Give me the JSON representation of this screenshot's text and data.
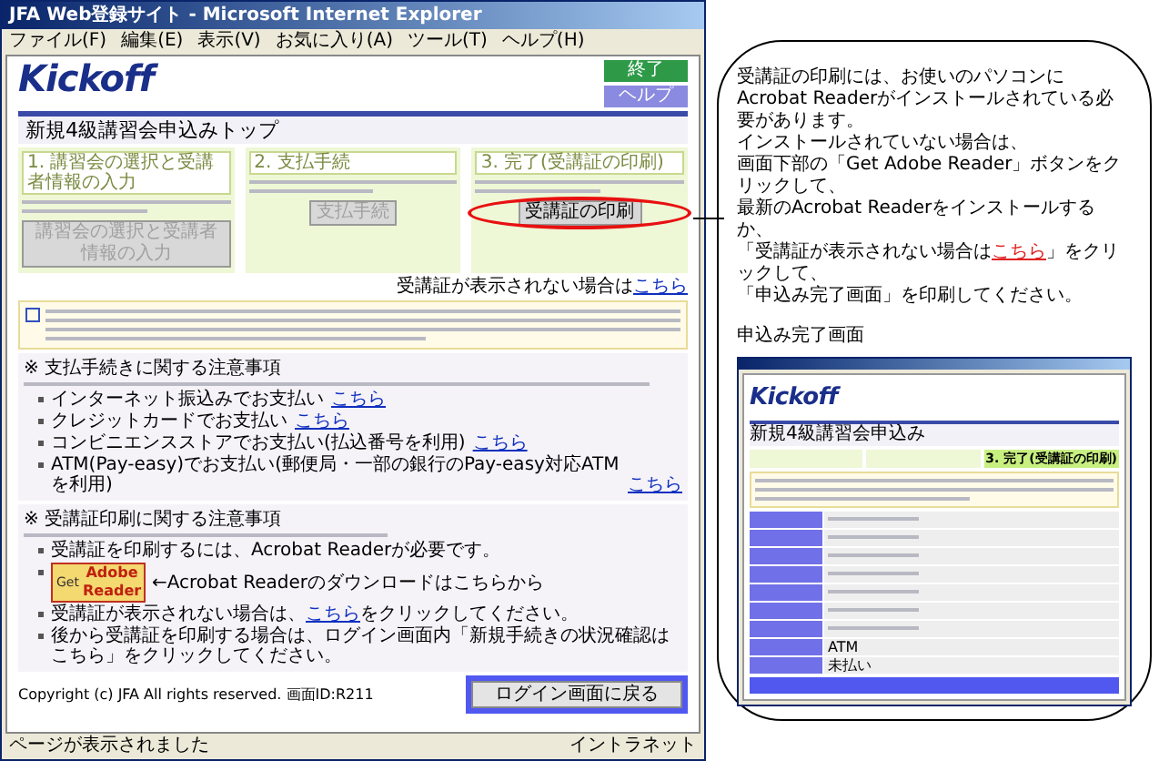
{
  "browser": {
    "title": "JFA Web登録サイト - Microsoft Internet Explorer",
    "menu": [
      "ファイル(F)",
      "編集(E)",
      "表示(V)",
      "お気に入り(A)",
      "ツール(T)",
      "ヘルプ(H)"
    ],
    "logo": "Kickoff",
    "top_buttons": [
      {
        "label": "終了",
        "kind": "exit"
      },
      {
        "label": "ヘルプ",
        "kind": "help"
      }
    ],
    "page_title": "新規4級講習会申込みトップ",
    "steps": [
      {
        "title": "1. 講習会の選択と受講者情報の入力",
        "button": "講習会の選択と受講者情報の入力",
        "disabled": true,
        "highlighted": false
      },
      {
        "title": "2. 支払手続",
        "button": "支払手続",
        "disabled": true,
        "highlighted": false
      },
      {
        "title": "3. 完了(受講証の印刷)",
        "button": "受講証の印刷",
        "disabled": false,
        "highlighted": true
      }
    ],
    "no_receipt": {
      "text": "受講証が表示されない場合は",
      "link": "こちら"
    },
    "payment_notes": {
      "heading": "※ 支払手続きに関する注意事項",
      "items": [
        {
          "title": "インターネット振込みでお支払い",
          "link": "こちら"
        },
        {
          "title": "クレジットカードでお支払い",
          "link": "こちら"
        },
        {
          "title": "コンビニエンスストアでお支払い(払込番号を利用)",
          "link": "こちら"
        },
        {
          "title": "ATM(Pay-easy)でお支払い(郵便局・一部の銀行のPay-easy対応ATMを利用)",
          "link": "こちら"
        }
      ]
    },
    "receipt_notes": {
      "heading": "※ 受講証印刷に関する注意事項",
      "items": [
        {
          "kind": "text",
          "text": "受講証を印刷するには、Acrobat Readerが必要です。"
        },
        {
          "kind": "adobe",
          "badge_small": "Get",
          "badge_big": "Adobe Reader",
          "text": "←Acrobat Readerのダウンロードはこちらから"
        },
        {
          "kind": "link",
          "before": "受講証が表示されない場合は、",
          "link": "こちら",
          "after": "をクリックしてください。"
        },
        {
          "kind": "text",
          "text": "後から受講証を印刷する場合は、ログイン画面内「新規手続きの状況確認はこちら」をクリックしてください。"
        }
      ]
    },
    "copyright": "Copyright (c) JFA All rights reserved.  画面ID:R211",
    "back_button": "ログイン画面に戻る",
    "status": {
      "text": "ページが表示されました",
      "zone": "イントラネット"
    }
  },
  "callout": {
    "lines": [
      [
        {
          "text": "受講証の印刷には、お使いのパソコンに"
        }
      ],
      [
        {
          "text": "Acrobat Readerがインストールされている必要があります。"
        }
      ],
      [
        {
          "text": "インストールされていない場合は、"
        }
      ],
      [
        {
          "text": "画面下部の「Get Adobe Reader」ボタンをクリックして、"
        }
      ],
      [
        {
          "text": "最新のAcrobat Readerをインストールするか、"
        }
      ],
      [
        {
          "text": "「受講証が表示されない場合は"
        },
        {
          "text": "こちら",
          "link": true
        },
        {
          "text": "」をクリックして、"
        }
      ],
      [
        {
          "text": "「申込み完了画面」を印刷してください。"
        }
      ]
    ],
    "caption": "申込み完了画面",
    "screen": {
      "logo": "Kickoff",
      "page_title": "新規4級講習会申込み",
      "steps": [
        {
          "selected": false
        },
        {
          "selected": false
        },
        {
          "label": "3. 完了(受講証の印刷)",
          "selected": true
        }
      ],
      "rows": [
        {
          "value": ""
        },
        {
          "value": ""
        },
        {
          "value": ""
        },
        {
          "value": ""
        },
        {
          "value": ""
        },
        {
          "value": ""
        },
        {
          "value": ""
        },
        {
          "value": "ATM"
        },
        {
          "value": "未払い"
        }
      ]
    }
  }
}
